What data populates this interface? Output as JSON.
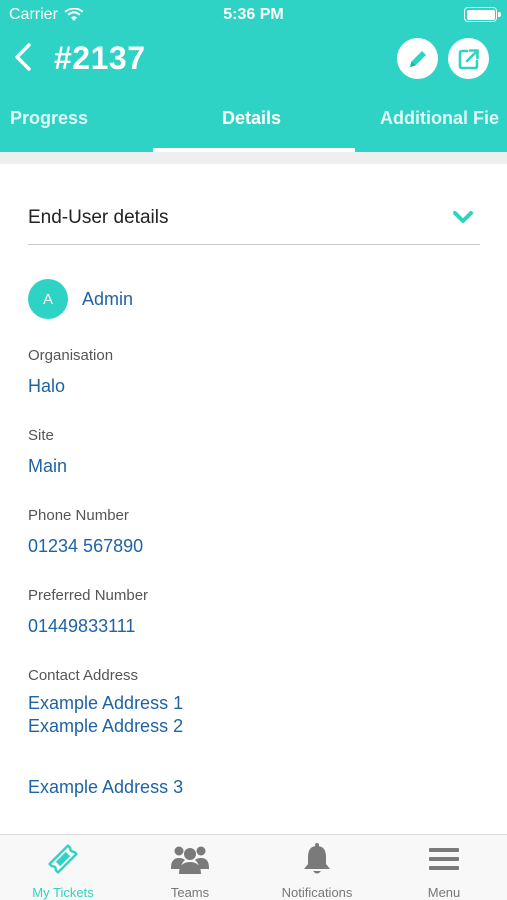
{
  "status_bar": {
    "carrier": "Carrier",
    "time": "5:36 PM"
  },
  "header": {
    "title": "#2137"
  },
  "tabs": [
    {
      "label": "Progress"
    },
    {
      "label": "Details"
    },
    {
      "label": "Additional Fie"
    }
  ],
  "section": {
    "title": "End-User details"
  },
  "user": {
    "initial": "A",
    "name": "Admin"
  },
  "fields": {
    "organisation": {
      "label": "Organisation",
      "value": "Halo"
    },
    "site": {
      "label": "Site",
      "value": "Main"
    },
    "phone": {
      "label": "Phone Number",
      "value": "01234 567890"
    },
    "preferred": {
      "label": "Preferred Number",
      "value": "01449833111"
    },
    "address": {
      "label": "Contact Address",
      "lines": [
        "Example Address 1",
        "Example Address 2",
        "Example Address 3"
      ]
    }
  },
  "tabbar": {
    "items": [
      {
        "label": "My Tickets",
        "icon": "ticket-icon"
      },
      {
        "label": "Teams",
        "icon": "teams-icon"
      },
      {
        "label": "Notifications",
        "icon": "bell-icon"
      },
      {
        "label": "Menu",
        "icon": "hamburger-icon"
      }
    ]
  },
  "colors": {
    "accent": "#2ed3c5",
    "link": "#1f63a3"
  }
}
